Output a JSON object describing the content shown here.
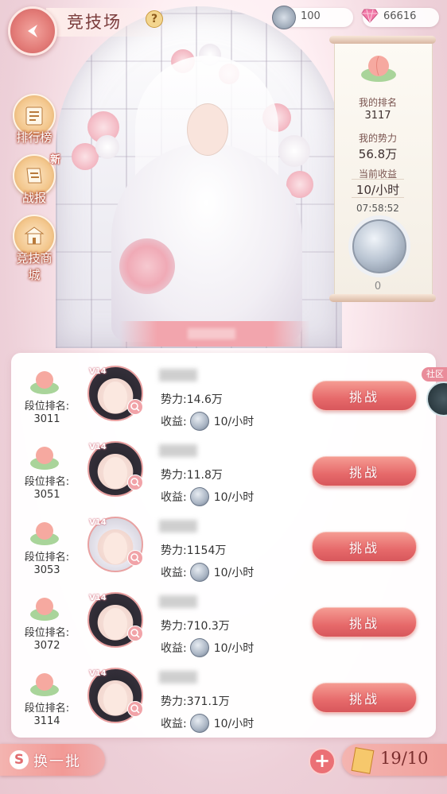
{
  "header": {
    "title": "竞技场",
    "help_label": "?"
  },
  "currencies": {
    "silver_coin": "100",
    "diamond": "66616"
  },
  "side_menu": [
    {
      "label": "排行榜",
      "icon": "leaderboard-icon"
    },
    {
      "label": "战报",
      "icon": "battle-report-icon",
      "badge": "新"
    },
    {
      "label": "竞技商城",
      "icon": "arena-shop-icon"
    }
  ],
  "my_stats": {
    "rank_label": "我的排名",
    "rank_value": "3117",
    "power_label": "我的势力",
    "power_value": "56.8万",
    "income_label": "当前收益",
    "income_value": "10/小时",
    "timer": "07:58:52",
    "coin_count": "0"
  },
  "opponents": [
    {
      "rank_label": "段位排名:",
      "rank": "3011",
      "vip": "V14",
      "power": "势力:14.6万",
      "income_label": "收益:",
      "income": "10/小时",
      "button": "挑战"
    },
    {
      "rank_label": "段位排名:",
      "rank": "3051",
      "vip": "V14",
      "power": "势力:11.8万",
      "income_label": "收益:",
      "income": "10/小时",
      "button": "挑战"
    },
    {
      "rank_label": "段位排名:",
      "rank": "3053",
      "vip": "V14",
      "power": "势力:1154万",
      "income_label": "收益:",
      "income": "10/小时",
      "button": "挑战"
    },
    {
      "rank_label": "段位排名:",
      "rank": "3072",
      "vip": "V14",
      "power": "势力:710.3万",
      "income_label": "收益:",
      "income": "10/小时",
      "button": "挑战"
    },
    {
      "rank_label": "段位排名:",
      "rank": "3114",
      "vip": "V14",
      "power": "势力:371.1万",
      "income_label": "收益:",
      "income": "10/小时",
      "button": "挑战"
    }
  ],
  "community_tab": "社区",
  "footer": {
    "refresh_label": "换一批",
    "tickets": "19/10",
    "plus_label": "+"
  },
  "colors": {
    "accent": "#e6696a",
    "title": "#7a3b3b",
    "panel": "#ffffff"
  }
}
